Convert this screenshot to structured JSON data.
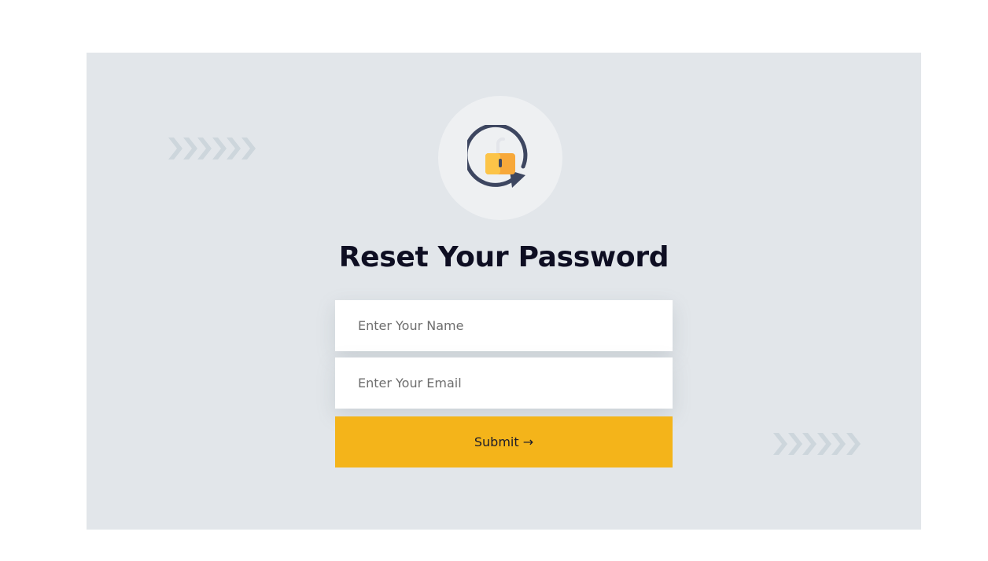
{
  "form": {
    "title": "Reset Your Password",
    "name_placeholder": "Enter Your Name",
    "email_placeholder": "Enter Your Email",
    "name_value": "",
    "email_value": "",
    "submit_label": "Submit →"
  },
  "icons": {
    "hero": "unlock-reset-icon",
    "decor": "chevrons-icon"
  },
  "colors": {
    "panel_bg": "#e2e6ea",
    "accent": "#f4b41a",
    "title": "#0e0e22",
    "chevron": "#cdd6dc",
    "icon_dark": "#3d4660",
    "lock_orange": "#f7a83a"
  }
}
